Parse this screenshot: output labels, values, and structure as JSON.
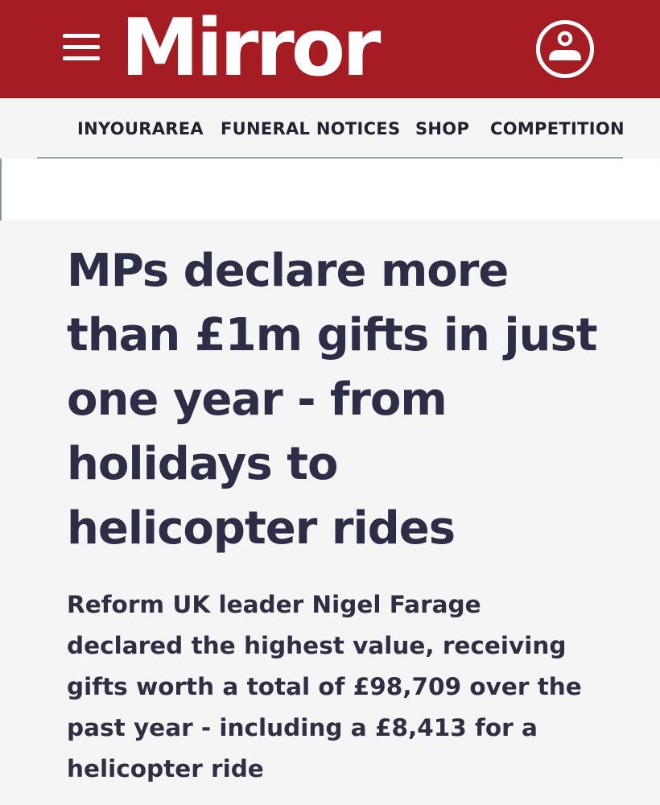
{
  "header": {
    "logo_text": "Mirror",
    "menu_icon": "hamburger-menu-icon",
    "account_icon": "user-account-icon",
    "brand_color": "#a61c23"
  },
  "nav": {
    "items": [
      {
        "label": "INYOURAREA"
      },
      {
        "label": "FUNERAL NOTICES"
      },
      {
        "label": "SHOP"
      },
      {
        "label": "COMPETITION"
      }
    ]
  },
  "article": {
    "headline": "MPs declare more than £1m gifts in just one year - from holidays to helicopter rides",
    "standfirst": "Reform UK leader Nigel Farage declared the highest value, receiving gifts worth a total of £98,709 over the past year - including a £8,413 for a helicopter ride",
    "text_color": "#2e2d47"
  }
}
